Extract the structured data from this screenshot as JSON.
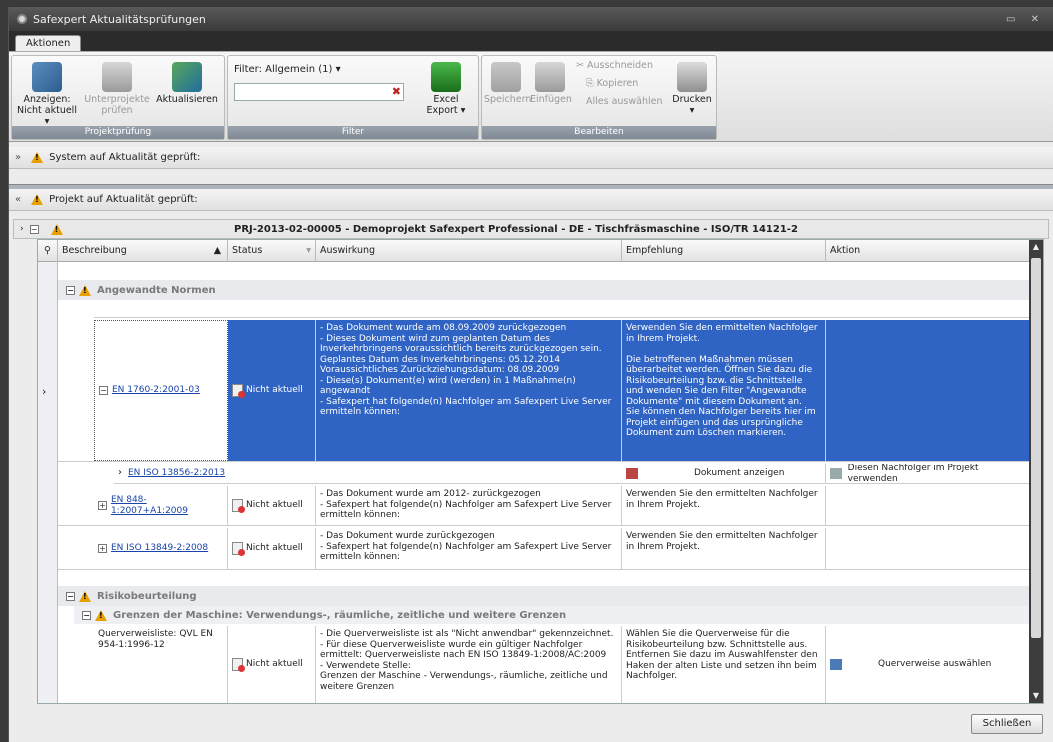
{
  "window": {
    "title": "Safexpert Aktualitätsprüfungen"
  },
  "ribbon": {
    "tab": "Aktionen",
    "groups": {
      "projektpruefung": {
        "label": "Projektprüfung",
        "anzeigen": "Anzeigen:",
        "anzeigen_value": "Nicht aktuell",
        "unterprojekte": "Unterprojekte",
        "unterprojekte2": "prüfen",
        "aktualisieren": "Aktualisieren"
      },
      "filter": {
        "label": "Filter",
        "filter_title": "Filter: Allgemein (1)",
        "excel": "Excel",
        "export": "Export"
      },
      "bearbeiten": {
        "label": "Bearbeiten",
        "speichern": "Speichern",
        "einfuegen": "Einfügen",
        "ausschneiden": "Ausschneiden",
        "kopieren": "Kopieren",
        "alles_auswaehlen": "Alles auswählen",
        "drucken": "Drucken"
      }
    }
  },
  "sections": {
    "system": "System auf Aktualität geprüft:",
    "projekt": "Projekt auf Aktualität geprüft:"
  },
  "project": {
    "title": "PRJ-2013-02-00005 - Demoprojekt Safexpert Professional - DE - Tischfräsmaschine - ISO/TR 14121-2"
  },
  "grid": {
    "columns": [
      "Beschreibung",
      "Status",
      "Auswirkung",
      "Empfehlung",
      "Aktion"
    ],
    "groups": {
      "normen": "Angewandte Normen",
      "risiko": "Risikobeurteilung",
      "grenzen": "Grenzen der Maschine: Verwendungs-, räumliche, zeitliche und weitere Grenzen"
    },
    "rows": [
      {
        "desc": "EN 1760-2:2001-03",
        "status": "Nicht aktuell",
        "effect": "- Das Dokument wurde am 08.09.2009 zurückgezogen\n- Dieses Dokument wird zum geplanten Datum des Inverkehrbringens voraussichtlich bereits zurückgezogen sein.\nGeplantes Datum des Inverkehrbringens: 05.12.2014\nVoraussichtliches Zurückziehungsdatum: 08.09.2009\n- Diese(s) Dokument(e) wird (werden) in 1 Maßnahme(n) angewandt\n- Safexpert hat folgende(n) Nachfolger am Safexpert Live Server ermitteln können:",
        "recommend": "Verwenden Sie den ermittelten Nachfolger in Ihrem Projekt.\n\nDie betroffenen Maßnahmen müssen überarbeitet werden. Öffnen Sie dazu die Risikobeurteilung bzw. die Schnittstelle und wenden Sie den Filter \"Angewandte Dokumente\" mit diesem Dokument an.\nSie können den Nachfolger bereits hier im Projekt einfügen und das ursprüngliche Dokument zum Löschen markieren."
      },
      {
        "desc": "EN 848-1:2007+A1:2009",
        "status": "Nicht aktuell",
        "effect": "- Das Dokument wurde am 2012- zurückgezogen\n- Safexpert hat folgende(n) Nachfolger am Safexpert Live Server ermitteln können:",
        "recommend": "Verwenden Sie den ermittelten Nachfolger in Ihrem Projekt."
      },
      {
        "desc": "EN ISO 13849-2:2008",
        "status": "Nicht aktuell",
        "effect": "- Das Dokument wurde zurückgezogen\n- Safexpert hat folgende(n) Nachfolger am Safexpert Live Server ermitteln können:",
        "recommend": "Verwenden Sie den ermittelten Nachfolger in Ihrem Projekt."
      },
      {
        "desc": "Querverweisliste: QVL EN 954-1:1996-12",
        "status": "Nicht aktuell",
        "effect": "- Die Querverweisliste ist als \"Nicht anwendbar\" gekennzeichnet.\n- Für diese Querverweisliste wurde ein gültiger Nachfolger ermittelt: Querverweisliste nach EN ISO 13849-1:2008/AC:2009\n- Verwendete Stelle:\n   Grenzen der Maschine - Verwendungs-, räumliche, zeitliche und weitere Grenzen",
        "recommend": "Wählen Sie die Querverweise für die Risikobeurteilung bzw. Schnittstelle aus. Entfernen Sie dazu im Auswahlfenster den Haken der alten Liste und setzen ihn beim Nachfolger.",
        "action": "Querverweise auswählen"
      }
    ],
    "successor": {
      "desc": "EN ISO 13856-2:2013",
      "show_doc": "Dokument anzeigen",
      "use_successor": "Diesen Nachfolger im Projekt verwenden"
    }
  },
  "footer": {
    "close": "Schließen"
  }
}
